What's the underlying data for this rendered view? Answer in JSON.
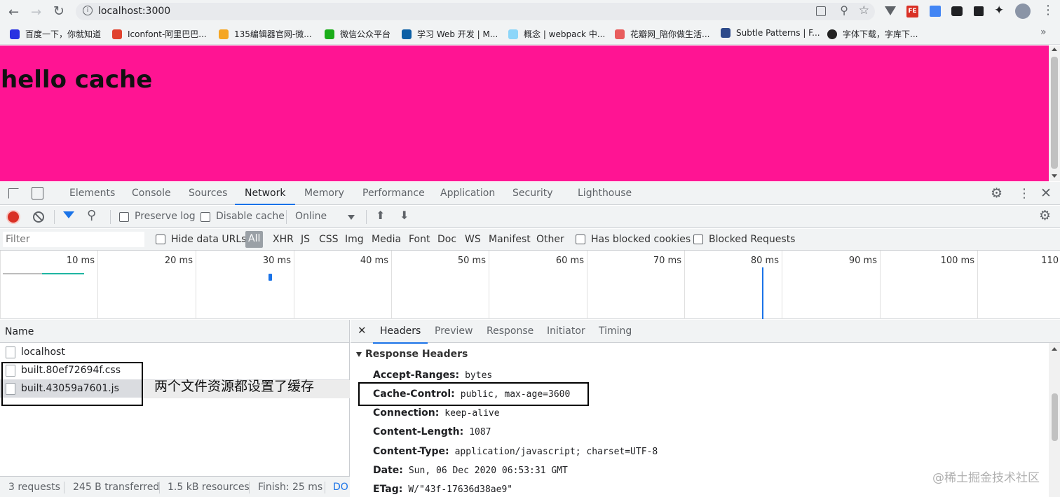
{
  "browser": {
    "url": "localhost:3000",
    "bookmarks": [
      {
        "label": "百度一下，你就知道",
        "color": "#2932e1"
      },
      {
        "label": "Iconfont-阿里巴巴...",
        "color": "#e0432f"
      },
      {
        "label": "135编辑器官网-微...",
        "color": "#f5a623"
      },
      {
        "label": "微信公众平台",
        "color": "#1aad19"
      },
      {
        "label": "学习 Web 开发 | M...",
        "color": "#0b5fa5"
      },
      {
        "label": "概念 | webpack 中...",
        "color": "#8dd6f9"
      },
      {
        "label": "花瓣网_陪你做生活...",
        "color": "#e85c5c"
      },
      {
        "label": "Subtle Patterns | F...",
        "color": "#2d4a8a"
      },
      {
        "label": "字体下载，字库下...",
        "color": "#222222"
      }
    ]
  },
  "page": {
    "heading": "hello cache",
    "background": "#ff1493"
  },
  "devtools": {
    "tabs": [
      "Elements",
      "Console",
      "Sources",
      "Network",
      "Memory",
      "Performance",
      "Application",
      "Security",
      "Lighthouse"
    ],
    "active_tab": "Network",
    "toolbar": {
      "preserve_log": "Preserve log",
      "disable_cache": "Disable cache",
      "throttle": "Online"
    },
    "filter": {
      "placeholder": "Filter",
      "hide_data_urls": "Hide data URLs",
      "types": [
        "All",
        "XHR",
        "JS",
        "CSS",
        "Img",
        "Media",
        "Font",
        "Doc",
        "WS",
        "Manifest",
        "Other"
      ],
      "has_blocked_cookies": "Has blocked cookies",
      "blocked_requests": "Blocked Requests"
    },
    "timeline_ticks": [
      "10 ms",
      "20 ms",
      "30 ms",
      "40 ms",
      "50 ms",
      "60 ms",
      "70 ms",
      "80 ms",
      "90 ms",
      "100 ms",
      "110"
    ],
    "requests_header": "Name",
    "requests": [
      "localhost",
      "built.80ef72694f.css",
      "built.43059a7601.js"
    ],
    "annotation": "两个文件资源都设置了缓存",
    "status": {
      "requests": "3 requests",
      "transferred": "245 B transferred",
      "resources": "1.5 kB resources",
      "finish": "Finish: 25 ms",
      "dom": "DO"
    },
    "detail_tabs": [
      "Headers",
      "Preview",
      "Response",
      "Initiator",
      "Timing"
    ],
    "active_detail_tab": "Headers",
    "section_title": "Response Headers",
    "headers": [
      {
        "name": "Accept-Ranges:",
        "value": "bytes"
      },
      {
        "name": "Cache-Control:",
        "value": "public, max-age=3600"
      },
      {
        "name": "Connection:",
        "value": "keep-alive"
      },
      {
        "name": "Content-Length:",
        "value": "1087"
      },
      {
        "name": "Content-Type:",
        "value": "application/javascript; charset=UTF-8"
      },
      {
        "name": "Date:",
        "value": "Sun, 06 Dec 2020 06:53:31 GMT"
      },
      {
        "name": "ETag:",
        "value": "W/\"43f-17636d38ae9\""
      }
    ],
    "watermark": "@稀土掘金技术社区"
  }
}
